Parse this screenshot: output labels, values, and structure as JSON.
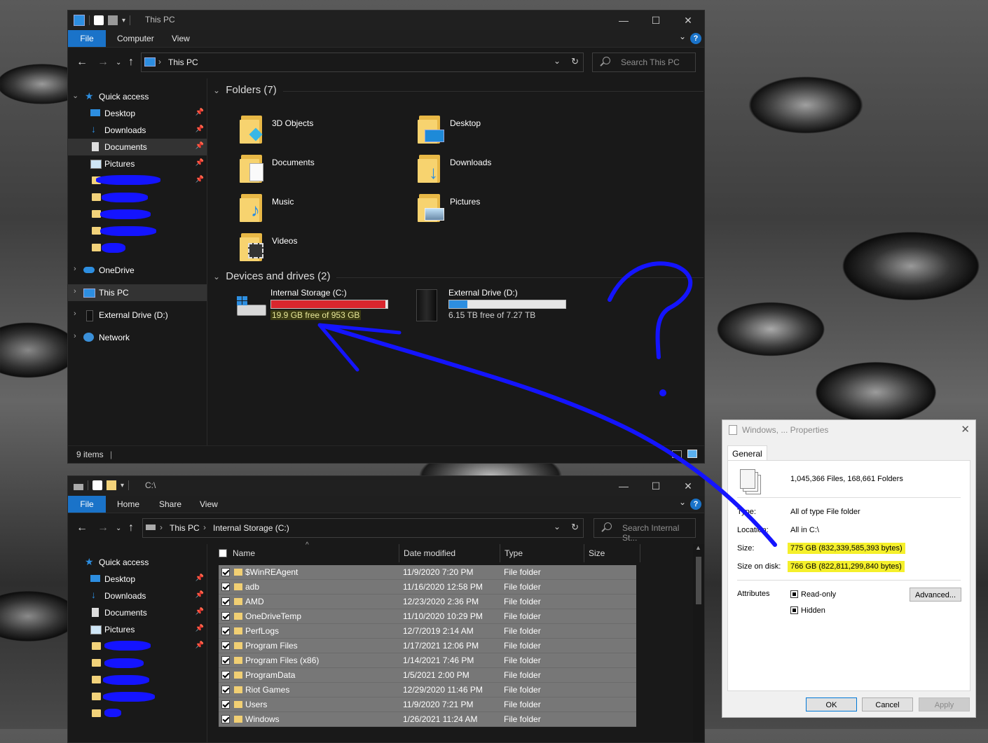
{
  "win1": {
    "title": "This PC",
    "tabs": [
      "File",
      "Computer",
      "View"
    ],
    "help": "?",
    "crumbs": [
      "This PC"
    ],
    "search_placeholder": "Search This PC",
    "nav": {
      "quick_access": "Quick access",
      "items": [
        {
          "label": "Desktop",
          "icon": "desktop-icon"
        },
        {
          "label": "Downloads",
          "icon": "download-arrow-icon"
        },
        {
          "label": "Documents",
          "icon": "documents-icon"
        },
        {
          "label": "Pictures",
          "icon": "pictures-icon"
        }
      ],
      "onedrive": "OneDrive",
      "this_pc": "This PC",
      "external": "External Drive (D:)",
      "network": "Network"
    },
    "folders_header": "Folders (7)",
    "folders": [
      "3D Objects",
      "Desktop",
      "Documents",
      "Downloads",
      "Music",
      "Pictures",
      "Videos"
    ],
    "devices_header": "Devices and drives (2)",
    "drives": [
      {
        "name": "Internal Storage (C:)",
        "free": "19.9 GB free of 953 GB",
        "used_fraction": 0.979,
        "color": "#d9262e"
      },
      {
        "name": "External Drive (D:)",
        "free": "6.15 TB free of 7.27 TB",
        "used_fraction": 0.154,
        "color": "#2d8ee0"
      }
    ],
    "status": "9 items"
  },
  "win2": {
    "title": "C:\\",
    "tabs": [
      "File",
      "Home",
      "Share",
      "View"
    ],
    "help": "?",
    "crumbs": [
      "This PC",
      "Internal Storage (C:)"
    ],
    "search_placeholder": "Search Internal St...",
    "nav": {
      "quick_access": "Quick access",
      "items": [
        {
          "label": "Desktop",
          "icon": "desktop-icon"
        },
        {
          "label": "Downloads",
          "icon": "download-arrow-icon"
        },
        {
          "label": "Documents",
          "icon": "documents-icon"
        },
        {
          "label": "Pictures",
          "icon": "pictures-icon"
        }
      ]
    },
    "columns": [
      "Name",
      "Date modified",
      "Type",
      "Size"
    ],
    "rows": [
      {
        "name": "$WinREAgent",
        "date": "11/9/2020 7:20 PM",
        "type": "File folder"
      },
      {
        "name": "adb",
        "date": "11/16/2020 12:58 PM",
        "type": "File folder"
      },
      {
        "name": "AMD",
        "date": "12/23/2020 2:36 PM",
        "type": "File folder"
      },
      {
        "name": "OneDriveTemp",
        "date": "11/10/2020 10:29 PM",
        "type": "File folder"
      },
      {
        "name": "PerfLogs",
        "date": "12/7/2019 2:14 AM",
        "type": "File folder"
      },
      {
        "name": "Program Files",
        "date": "1/17/2021 12:06 PM",
        "type": "File folder"
      },
      {
        "name": "Program Files (x86)",
        "date": "1/14/2021 7:46 PM",
        "type": "File folder"
      },
      {
        "name": "ProgramData",
        "date": "1/5/2021 2:00 PM",
        "type": "File folder"
      },
      {
        "name": "Riot Games",
        "date": "12/29/2020 11:46 PM",
        "type": "File folder"
      },
      {
        "name": "Users",
        "date": "11/9/2020 7:21 PM",
        "type": "File folder"
      },
      {
        "name": "Windows",
        "date": "1/26/2021 11:24 AM",
        "type": "File folder"
      }
    ]
  },
  "dialog": {
    "title": "Windows, ... Properties",
    "tab": "General",
    "summary": "1,045,366 Files, 168,661 Folders",
    "type_label": "Type:",
    "type_value": "All of type File folder",
    "location_label": "Location:",
    "location_value": "All in C:\\",
    "size_label": "Size:",
    "size_value": "775 GB (832,339,585,393 bytes)",
    "size_disk_label": "Size on disk:",
    "size_disk_value": "766 GB (822,811,299,840 bytes)",
    "attributes_label": "Attributes",
    "readonly": "Read-only",
    "hidden": "Hidden",
    "advanced": "Advanced...",
    "ok": "OK",
    "cancel": "Cancel",
    "apply": "Apply"
  },
  "colors": {
    "accent": "#1a73c9",
    "annotation": "#1414ff",
    "highlight": "#f5f02b"
  }
}
